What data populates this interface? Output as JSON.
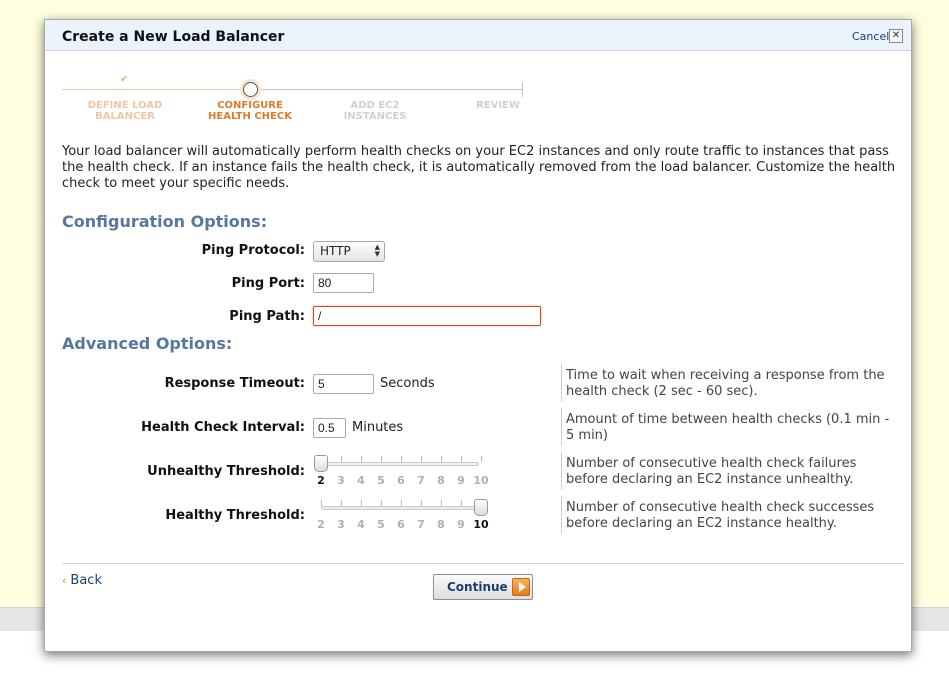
{
  "dialog": {
    "title": "Create a New Load Balancer",
    "cancel_label": "Cancel",
    "close_glyph": "✕"
  },
  "wizard": {
    "steps": [
      {
        "label": "DEFINE LOAD BALANCER",
        "line1": "DEFINE LOAD",
        "line2": "BALANCER",
        "status": "done"
      },
      {
        "label": "CONFIGURE HEALTH CHECK",
        "line1": "CONFIGURE",
        "line2": "HEALTH CHECK",
        "status": "active"
      },
      {
        "label": "ADD EC2 INSTANCES",
        "line1": "ADD EC2",
        "line2": "INSTANCES",
        "status": "todo"
      },
      {
        "label": "REVIEW",
        "line1": "REVIEW",
        "line2": "",
        "status": "todo"
      }
    ],
    "done_icon": "check-icon"
  },
  "intro_text": "Your load balancer will automatically perform health checks on your EC2 instances and only route traffic to instances that pass the health check. If an instance fails the health check, it is automatically removed from the load balancer. Customize the health check to meet your specific needs.",
  "configuration": {
    "title": "Configuration Options:",
    "ping_protocol": {
      "label": "Ping Protocol:",
      "value": "HTTP"
    },
    "ping_port": {
      "label": "Ping Port:",
      "value": "80"
    },
    "ping_path": {
      "label": "Ping Path:",
      "value": "/"
    }
  },
  "advanced": {
    "title": "Advanced Options:",
    "response_timeout": {
      "label": "Response Timeout:",
      "value": "5",
      "unit": "Seconds",
      "help": "Time to wait when receiving a response from the health check (2 sec - 60 sec)."
    },
    "health_check_interval": {
      "label": "Health Check Interval:",
      "value": "0.5",
      "unit": "Minutes",
      "help": "Amount of time between health checks (0.1 min - 5 min)"
    },
    "unhealthy_threshold": {
      "label": "Unhealthy Threshold:",
      "value": 2,
      "help": "Number of consecutive health check failures before declaring an EC2 instance unhealthy."
    },
    "healthy_threshold": {
      "label": "Healthy Threshold:",
      "value": 10,
      "help": "Number of consecutive health check successes before declaring an EC2 instance healthy."
    },
    "slider_scale": [
      "2",
      "3",
      "4",
      "5",
      "6",
      "7",
      "8",
      "9",
      "10"
    ]
  },
  "footer": {
    "back_label": "Back",
    "back_chevron": "‹",
    "continue_label": "Continue"
  },
  "colors": {
    "accent_orange": "#e07b28",
    "section_blue": "#5677a1",
    "link_blue": "#1a3f6b",
    "page_background": "#ffffdf"
  }
}
